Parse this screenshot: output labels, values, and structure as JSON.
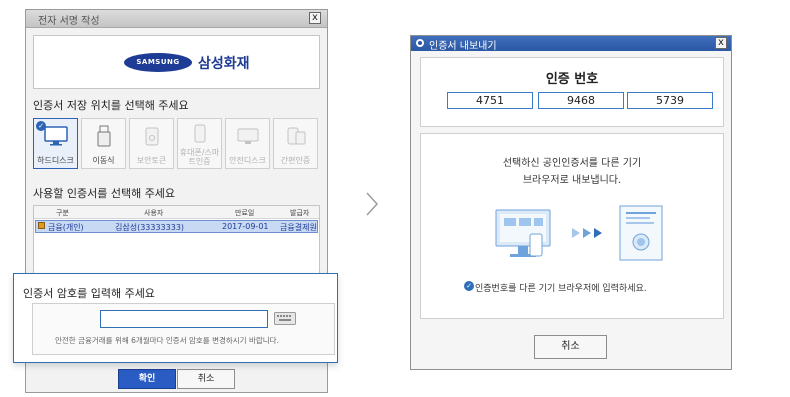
{
  "left_window": {
    "title": "전자 서명 작성",
    "close": "x",
    "logo": {
      "brand": "SAMSUNG",
      "company": "삼성화재"
    },
    "location_label": "인증서 저장 위치를 선택해 주세요",
    "devices": [
      {
        "label": "하드디스크",
        "icon": "monitor-icon",
        "selected": true
      },
      {
        "label": "이동식",
        "icon": "usb-icon",
        "selected": false
      },
      {
        "label": "보안토큰",
        "icon": "token-icon",
        "selected": false
      },
      {
        "label": "휴대폰/스마트인증",
        "icon": "phone-icon",
        "selected": false
      },
      {
        "label": "안전디스크",
        "icon": "safe-disk-icon",
        "selected": false
      },
      {
        "label": "간편인증",
        "icon": "simple-auth-icon",
        "selected": false
      }
    ],
    "cert_label": "사용할 인증서를 선택해 주세요",
    "table": {
      "headers": [
        "구분",
        "사용자",
        "만료일",
        "발급자"
      ],
      "rows": [
        {
          "type": "금융(개인)",
          "user": "김삼성(33333333)",
          "expiry": "2017-09-01",
          "issuer": "금융결제원"
        }
      ]
    },
    "ok_label": "확인",
    "cancel_label": "취소"
  },
  "password_popup": {
    "title": "인증서 암호를 입력해 주세요",
    "value": "",
    "hint": "안전한 금융거래를 위해 6개월마다 인증서 암호를 변경하시기 바랍니다."
  },
  "right_window": {
    "title": "인증서 내보내기",
    "close": "x",
    "code_title": "인증 번호",
    "codes": [
      "4751",
      "9468",
      "5739"
    ],
    "info_line1": "선택하신 공인인증서를 다른 기기",
    "info_line2": "브라우저로 내보냅니다.",
    "notice": "인증번호를 다른 기기 브라우저에 입력하세요.",
    "cancel_label": "취소"
  },
  "colors": {
    "accent": "#2e6fb5",
    "brand": "#1e3b95",
    "selection": "#c8d9f3"
  }
}
